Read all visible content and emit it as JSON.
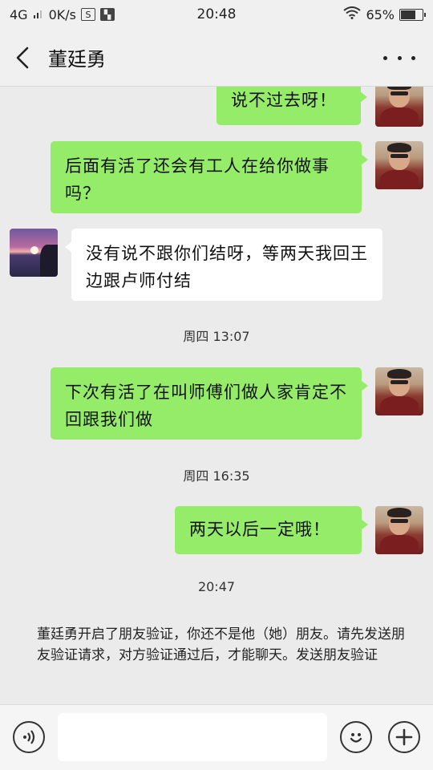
{
  "status_bar": {
    "network": "4G",
    "speed": "0K/s",
    "time": "20:48",
    "battery": "65%",
    "battery_level": 0.65
  },
  "header": {
    "title": "董廷勇"
  },
  "messages": [
    {
      "from": "me",
      "text": "说不过去呀！"
    },
    {
      "from": "me",
      "text": "后面有活了还会有工人在给你做事吗？"
    },
    {
      "from": "them",
      "text": "没有说不跟你们结呀，等两天我回王边跟卢师付结"
    },
    {
      "from": "me",
      "text": "下次有活了在叫师傅们做人家肯定不回跟我们做"
    },
    {
      "from": "me",
      "text": "两天以后一定哦！"
    }
  ],
  "timestamps": [
    "周四 13:07",
    "周四 16:35",
    "20:47"
  ],
  "system_note": {
    "text": "董廷勇开启了朋友验证，你还不是他（她）朋友。请先发送朋友验证请求，对方验证通过后，才能聊天。",
    "link": "发送朋友验证"
  },
  "input": {
    "value": ""
  },
  "colors": {
    "my_bubble": "#95ec69",
    "their_bubble": "#ffffff",
    "background": "#ebebeb"
  }
}
